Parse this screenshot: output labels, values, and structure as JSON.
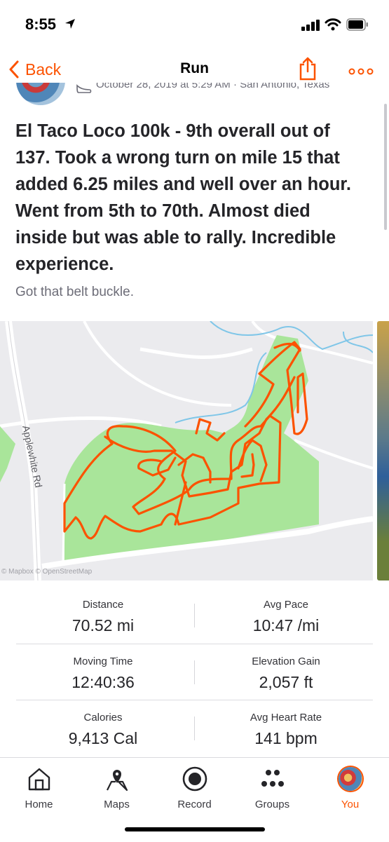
{
  "status_bar": {
    "time": "8:55"
  },
  "nav": {
    "back_label": "Back",
    "title": "Run"
  },
  "activity": {
    "meta": "October 28, 2019 at 5:29 AM · San Antonio, Texas",
    "title": "El Taco Loco 100k - 9th overall out of 137. Took a wrong turn on mile 15 that added 6.25 miles and well over an hour. Went from 5th to 70th. Almost died inside but was able to rally. Incredible experience.",
    "description": "Got that belt buckle."
  },
  "map": {
    "road_label": "Applewhite Rd",
    "attribution": "© Mapbox © OpenStreetMap",
    "route_color": "#fc5200",
    "park_color": "#a9e59a",
    "water_color": "#7fc6e8"
  },
  "stats": [
    {
      "label": "Distance",
      "value": "70.52 mi"
    },
    {
      "label": "Avg Pace",
      "value": "10:47 /mi"
    },
    {
      "label": "Moving Time",
      "value": "12:40:36"
    },
    {
      "label": "Elevation Gain",
      "value": "2,057 ft"
    },
    {
      "label": "Calories",
      "value": "9,413 Cal"
    },
    {
      "label": "Avg Heart Rate",
      "value": "141 bpm"
    }
  ],
  "tabs": [
    {
      "label": "Home",
      "icon": "home-icon"
    },
    {
      "label": "Maps",
      "icon": "map-pin-icon"
    },
    {
      "label": "Record",
      "icon": "record-icon"
    },
    {
      "label": "Groups",
      "icon": "groups-icon"
    },
    {
      "label": "You",
      "icon": "avatar"
    }
  ],
  "colors": {
    "accent": "#fc5200",
    "text": "#242428",
    "muted": "#6d6d78"
  }
}
